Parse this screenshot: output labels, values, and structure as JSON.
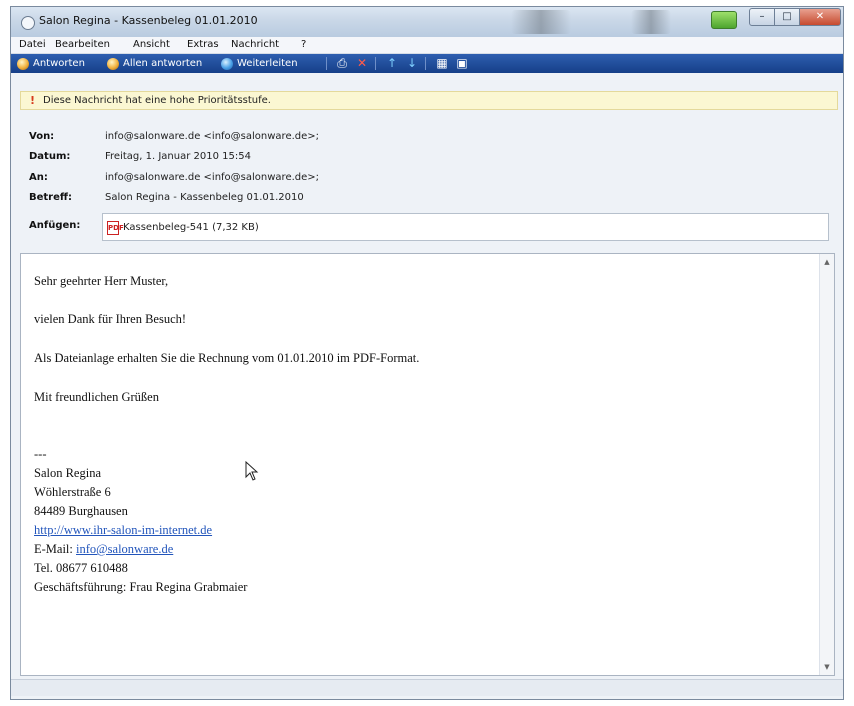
{
  "window": {
    "title": "Salon Regina - Kassenbeleg 01.01.2010",
    "close_glyph": "✕",
    "max_glyph": "□",
    "min_glyph": "–"
  },
  "menu": [
    "Datei",
    "Bearbeiten",
    "Ansicht",
    "Extras",
    "Nachricht",
    "?"
  ],
  "toolbar": {
    "reply": "Antworten",
    "reply_all": "Allen antworten",
    "forward": "Weiterleiten"
  },
  "priority": {
    "mark": "!",
    "text": "Diese Nachricht hat eine hohe Prioritätsstufe."
  },
  "header": {
    "from_label": "Von:",
    "from_value": "info@salonware.de <info@salonware.de>;",
    "date_label": "Datum:",
    "date_value": "Freitag, 1. Januar 2010 15:54",
    "to_label": "An:",
    "to_value": "info@salonware.de <info@salonware.de>;",
    "subject_label": "Betreff:",
    "subject_value": "Salon Regina - Kassenbeleg 01.01.2010",
    "attach_label": "Anfügen:",
    "attachment": "Kassenbeleg-541 (7,32 KB)"
  },
  "body": {
    "greeting": "Sehr geehrter Herr Muster,",
    "line1": "vielen Dank für Ihren Besuch!",
    "line2": "Als Dateianlage erhalten Sie die Rechnung vom 01.01.2010 im PDF-Format.",
    "closing": "Mit freundlichen Grüßen",
    "sig_sep": "---",
    "sig_name": "Salon Regina",
    "sig_street": "Wöhlerstraße 6",
    "sig_city": "84489 Burghausen",
    "sig_web": "http://www.ihr-salon-im-internet.de",
    "sig_email_label": "E-Mail:",
    "sig_email": "info@salonware.de",
    "sig_phone": "Tel. 08677 610488",
    "sig_ceo": "Geschäftsführung: Frau Regina Grabmaier"
  },
  "colors": {
    "toolbar": "#1f4c9c",
    "priority_bg": "#fbf7d2",
    "link": "#2255bb"
  }
}
